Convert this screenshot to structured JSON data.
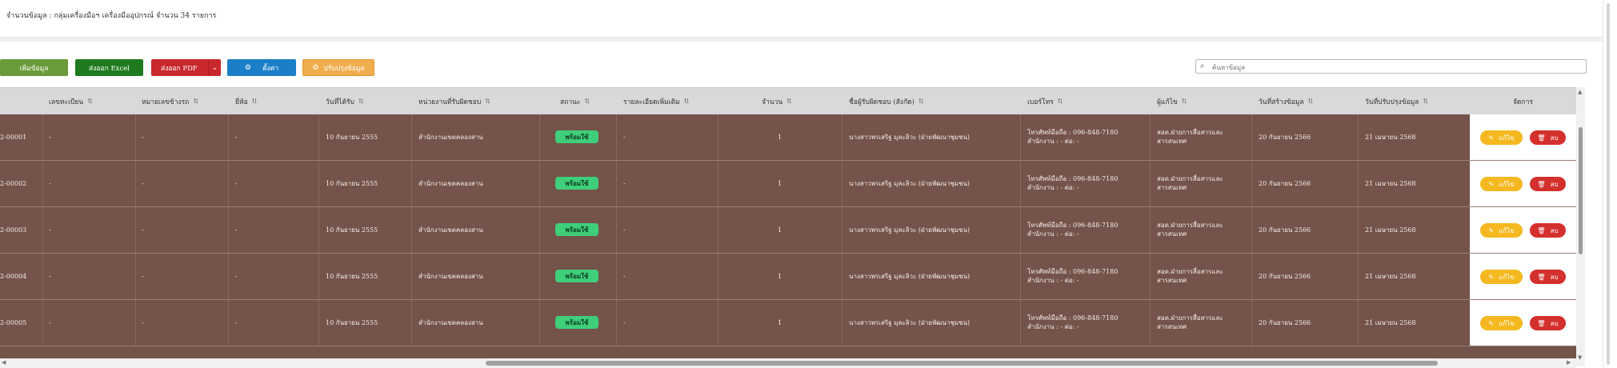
{
  "summary": {
    "text": "จำนวนข้อมูล : กลุ่มเครื่องมือฯ เครื่องมืออุปกรณ์  จำนวน 34 รายการ"
  },
  "toolbar": {
    "add_label": "เพิ่มข้อมูล",
    "excel_label": "ส่งออก Excel",
    "pdf_label": "ส่งออก PDF",
    "settings_label": "ตั้งค่า",
    "refresh_label": "ปรับปรุงข้อมูล"
  },
  "search": {
    "placeholder": "ค้นหาข้อมูล"
  },
  "table": {
    "columns": [
      "เลขทะเบียน",
      "หมายเลขข้างรถ",
      "ยี่ห้อ",
      "วันที่ได้รับ",
      "หน่วยงานที่รับผิดชอบ",
      "สถานะ",
      "รายละเอียดเพิ่มเติม",
      "จำนวน",
      "ชื่อผู้รับผิดชอบ (สังกัด)",
      "เบอร์โทร",
      "ผู้แก้ไข",
      "วันที่สร้างข้อมูล",
      "วันที่ปรับปรุงข้อมูล",
      "จัดการ"
    ],
    "sort_icon": "⇅",
    "rows": [
      {
        "code": "2-00001",
        "reg": "-",
        "plate": "-",
        "brand": "-",
        "received": "10 กันยายน 2555",
        "unit": "สำนักงานเขตคลองสาน",
        "status": "พร้อมใช้",
        "detail": "-",
        "qty": "1",
        "owner": "นางสาวพรเสริฐ มุละลิวะ (ฝ่ายพัฒนาชุมชน)",
        "phone1": "โทรศัพท์มือถือ : 096-848-7180",
        "phone2": "สำนักงาน : - ต่อ: -",
        "editor1": "สอด.ฝ่ายการสื่อสารและ",
        "editor2": "สารสนเทศ",
        "created": "20 กันยายน 2566",
        "updated": "21 เมษายน 2568",
        "edit_label": "แก้ไข",
        "delete_label": "ลบ"
      },
      {
        "code": "2-00002",
        "reg": "-",
        "plate": "-",
        "brand": "-",
        "received": "10 กันยายน 2555",
        "unit": "สำนักงานเขตคลองสาน",
        "status": "พร้อมใช้",
        "detail": "-",
        "qty": "1",
        "owner": "นางสาวพรเสริฐ มุละลิวะ (ฝ่ายพัฒนาชุมชน)",
        "phone1": "โทรศัพท์มือถือ : 096-848-7180",
        "phone2": "สำนักงาน : - ต่อ: -",
        "editor1": "สอด.ฝ่ายการสื่อสารและ",
        "editor2": "สารสนเทศ",
        "created": "20 กันยายน 2566",
        "updated": "21 เมษายน 2568",
        "edit_label": "แก้ไข",
        "delete_label": "ลบ"
      },
      {
        "code": "2-00003",
        "reg": "-",
        "plate": "-",
        "brand": "-",
        "received": "10 กันยายน 2555",
        "unit": "สำนักงานเขตคลองสาน",
        "status": "พร้อมใช้",
        "detail": "-",
        "qty": "1",
        "owner": "นางสาวพรเสริฐ มุละลิวะ (ฝ่ายพัฒนาชุมชน)",
        "phone1": "โทรศัพท์มือถือ : 096-848-7180",
        "phone2": "สำนักงาน : - ต่อ: -",
        "editor1": "สอด.ฝ่ายการสื่อสารและ",
        "editor2": "สารสนเทศ",
        "created": "20 กันยายน 2566",
        "updated": "21 เมษายน 2568",
        "edit_label": "แก้ไข",
        "delete_label": "ลบ"
      },
      {
        "code": "2-00004",
        "reg": "-",
        "plate": "-",
        "brand": "-",
        "received": "10 กันยายน 2555",
        "unit": "สำนักงานเขตคลองสาน",
        "status": "พร้อมใช้",
        "detail": "-",
        "qty": "1",
        "owner": "นางสาวพรเสริฐ มุละลิวะ (ฝ่ายพัฒนาชุมชน)",
        "phone1": "โทรศัพท์มือถือ : 096-848-7180",
        "phone2": "สำนักงาน : - ต่อ: -",
        "editor1": "สอด.ฝ่ายการสื่อสารและ",
        "editor2": "สารสนเทศ",
        "created": "20 กันยายน 2566",
        "updated": "21 เมษายน 2568",
        "edit_label": "แก้ไข",
        "delete_label": "ลบ"
      },
      {
        "code": "2-00005",
        "reg": "-",
        "plate": "-",
        "brand": "-",
        "received": "10 กันยายน 2555",
        "unit": "สำนักงานเขตคลองสาน",
        "status": "พร้อมใช้",
        "detail": "-",
        "qty": "1",
        "owner": "นางสาวพรเสริฐ มุละลิวะ (ฝ่ายพัฒนาชุมชน)",
        "phone1": "โทรศัพท์มือถือ : 096-848-7180",
        "phone2": "สำนักงาน : - ต่อ: -",
        "editor1": "สอด.ฝ่ายการสื่อสารและ",
        "editor2": "สารสนเทศ",
        "created": "20 กันยายน 2566",
        "updated": "21 เมษายน 2568",
        "edit_label": "แก้ไข",
        "delete_label": "ลบ"
      }
    ]
  },
  "colors": {
    "row_bg": "#74534a",
    "status_badge": "#3fce7a",
    "edit_button": "#f5b820",
    "delete_button": "#d4302e",
    "add_button": "#6a9a3a",
    "excel_button": "#1f7a1f",
    "pdf_button": "#c8282c",
    "settings_button": "#1a7fc8",
    "refresh_button": "#f0ad4e"
  }
}
